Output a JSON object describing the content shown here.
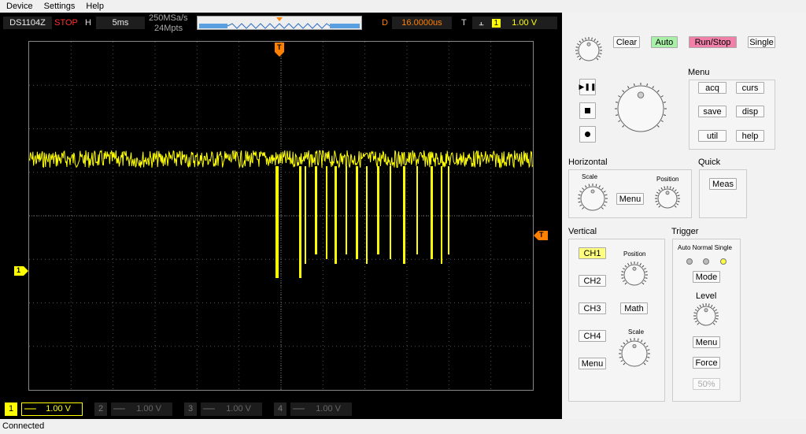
{
  "menubar": {
    "items": [
      "Device",
      "Settings",
      "Help"
    ]
  },
  "topbar": {
    "model": "DS1104Z",
    "run_state": "STOP",
    "h_label": "H",
    "timebase": "5ms",
    "sample_rate": "250MSa/s",
    "memory_depth": "24Mpts",
    "delay_label": "D",
    "delay_value": "16.0000us",
    "trigger_label": "T",
    "trigger_channel": "1",
    "trigger_level": "1.00 V"
  },
  "screen": {
    "trigger_marker": "T",
    "ch1_marker": "1",
    "trigger_level_marker": "T"
  },
  "channels": [
    {
      "num": "1",
      "coupling": "═══",
      "scale": "1.00 V",
      "active": true
    },
    {
      "num": "2",
      "coupling": "═══",
      "scale": "1.00 V",
      "active": false
    },
    {
      "num": "3",
      "coupling": "═══",
      "scale": "1.00 V",
      "active": false
    },
    {
      "num": "4",
      "coupling": "═══",
      "scale": "1.00 V",
      "active": false
    }
  ],
  "status": "Connected",
  "panel": {
    "clear": "Clear",
    "auto": "Auto",
    "runstop": "Run/Stop",
    "single": "Single",
    "menu_title": "Menu",
    "menu_buttons": [
      "acq",
      "curs",
      "save",
      "disp",
      "util",
      "help"
    ],
    "horizontal": {
      "title": "Horizontal",
      "scale": "Scale",
      "position": "Position",
      "menu": "Menu"
    },
    "quick": {
      "title": "Quick",
      "meas": "Meas"
    },
    "vertical": {
      "title": "Vertical",
      "ch1": "CH1",
      "ch2": "CH2",
      "ch3": "CH3",
      "ch4": "CH4",
      "menu": "Menu",
      "math": "Math",
      "position": "Position",
      "scale": "Scale"
    },
    "trigger": {
      "title": "Trigger",
      "modes": "Auto Normal Single",
      "mode": "Mode",
      "level": "Level",
      "menu": "Menu",
      "force": "Force",
      "fifty": "50%"
    }
  },
  "colors": {
    "ch1": "#ffff00",
    "trigger": "#ff7f00",
    "auto_btn": "#a8f0a8",
    "runstop_btn": "#f080a8"
  },
  "icons": [
    "play-pause-icon",
    "stop-icon",
    "record-icon"
  ]
}
